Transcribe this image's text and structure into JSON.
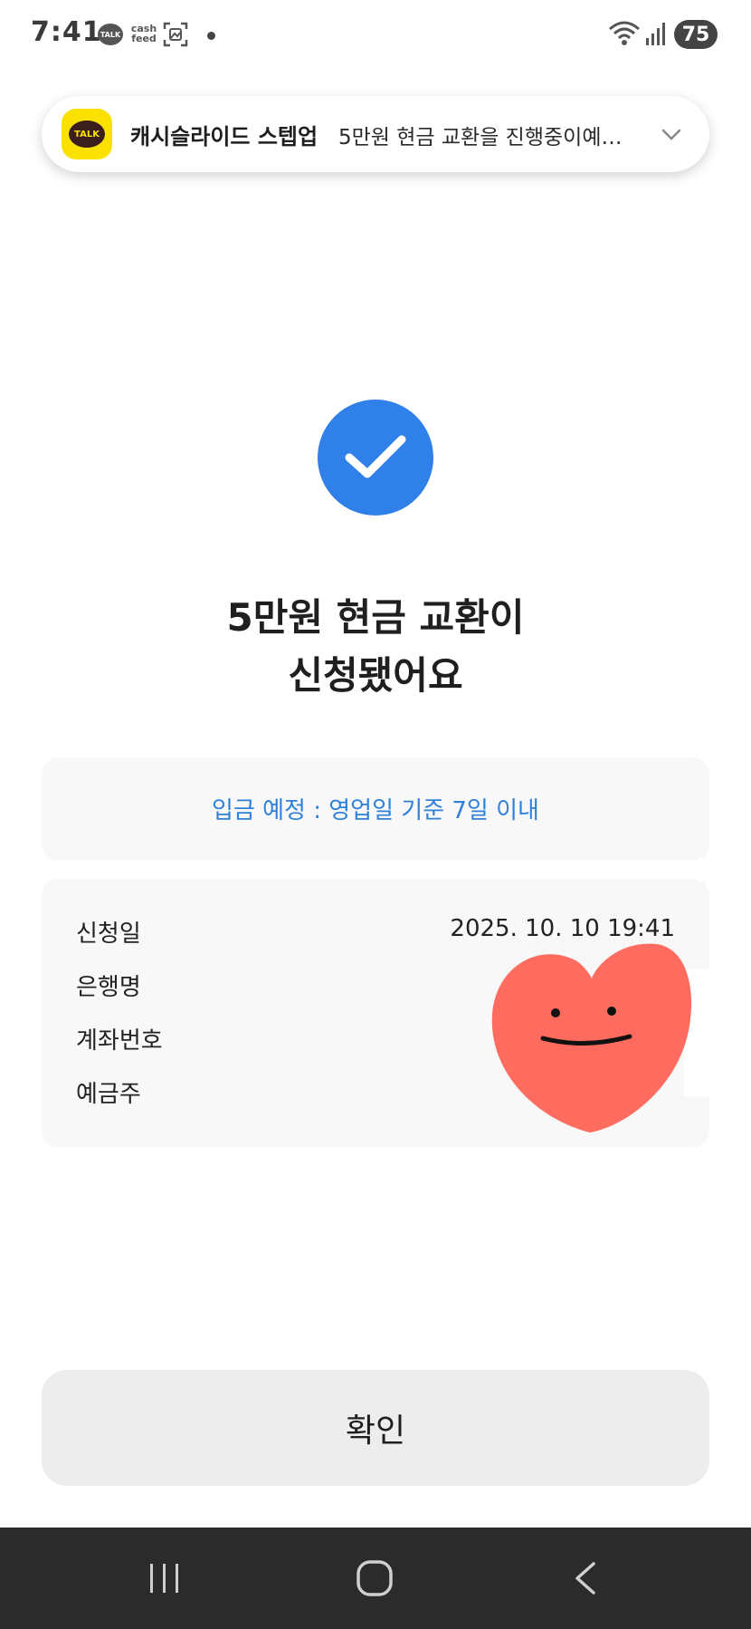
{
  "status_bar": {
    "time": "7:41",
    "talk_icon_text": "TALK",
    "cashfeed_icon_text": "cash feed",
    "battery": "75",
    "icons": [
      "talk-icon",
      "cashfeed-icon",
      "screenshot-icon",
      "dot-icon",
      "wifi-icon",
      "signal-icon"
    ]
  },
  "notification": {
    "app_icon_text": "TALK",
    "title": "캐시슬라이드 스텝업",
    "text": "5만원 현금 교환을 진행중이예…"
  },
  "main": {
    "headline_line1": "5만원 현금 교환이",
    "headline_line2": "신청됐어요",
    "deposit_notice": "입금 예정 : 영업일 기준 7일 이내",
    "details": {
      "request_date_label": "신청일",
      "request_date_value": "2025. 10. 10 19:41",
      "bank_label": "은행명",
      "account_label": "계좌번호",
      "holder_label": "예금주"
    },
    "confirm_label": "확인"
  },
  "colors": {
    "accent_blue": "#2f80e9",
    "deposit_text": "#2f80d9",
    "heart": "#ff6b5e",
    "nav_bar": "#2b2b2b"
  }
}
